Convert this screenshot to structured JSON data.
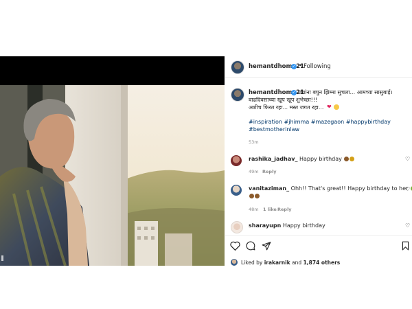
{
  "post": {
    "author": "hemantdhome21",
    "follow_status": "Following",
    "dot": "•",
    "caption_lines": [
      "ज्यांना बघुन झिम्मा सुचला... आमच्या सासुबाई।",
      "वाढदिवसाच्या खूप खूप शुभेच्छा!!!",
      "अशीच फिरत रहा... मस्त जगत रहा..."
    ],
    "hashtags_line1": "#inspiration #jhimma #mazegaon #happybirthday",
    "hashtags_line2": "#bestmotherinlaw",
    "caption_age": "53m",
    "likes_prefix": "Liked by",
    "likes_user": "irakarnik",
    "likes_and": "and",
    "likes_count": "1,874 others"
  },
  "comments": [
    {
      "user": "rashika_jadhav_",
      "text": "Happy birthday",
      "age": "49m",
      "reply": "Reply"
    },
    {
      "user": "vanitaziman_",
      "text_line1": "Ohh!! That's great!! Happy birthday to her",
      "age": "48m",
      "likes": "1 like",
      "reply": "Reply"
    },
    {
      "user": "sharayupn",
      "text": "Happy birthday"
    }
  ],
  "icons": {
    "verified": "verified-badge-icon",
    "heart": "heart-icon",
    "comment": "comment-icon",
    "share": "share-icon",
    "save": "bookmark-icon"
  },
  "colors": {
    "accent_link": "#00376b",
    "verified_blue": "#3897f0",
    "meta_gray": "#8e8e8e"
  }
}
